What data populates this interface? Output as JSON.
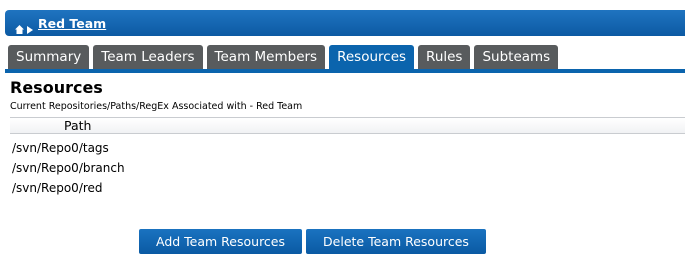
{
  "header": {
    "home_icon": "home-icon",
    "separator_icon": "chevron-right-icon",
    "team_name": "Red Team",
    "bar_color": "#0c5aa3"
  },
  "tabs": [
    {
      "label": "Summary",
      "active": false
    },
    {
      "label": "Team Leaders",
      "active": false
    },
    {
      "label": "Team Members",
      "active": false
    },
    {
      "label": "Resources",
      "active": true
    },
    {
      "label": "Rules",
      "active": false
    },
    {
      "label": "Subteams",
      "active": false
    }
  ],
  "main": {
    "title": "Resources",
    "subtitle": "Current Repositories/Paths/RegEx Associated with - Red Team",
    "table": {
      "column_header": "Path",
      "rows": [
        "/svn/Repo0/tags",
        "/svn/Repo0/branch",
        "/svn/Repo0/red"
      ]
    }
  },
  "actions": {
    "add_label": "Add Team Resources",
    "delete_label": "Delete Team Resources"
  }
}
